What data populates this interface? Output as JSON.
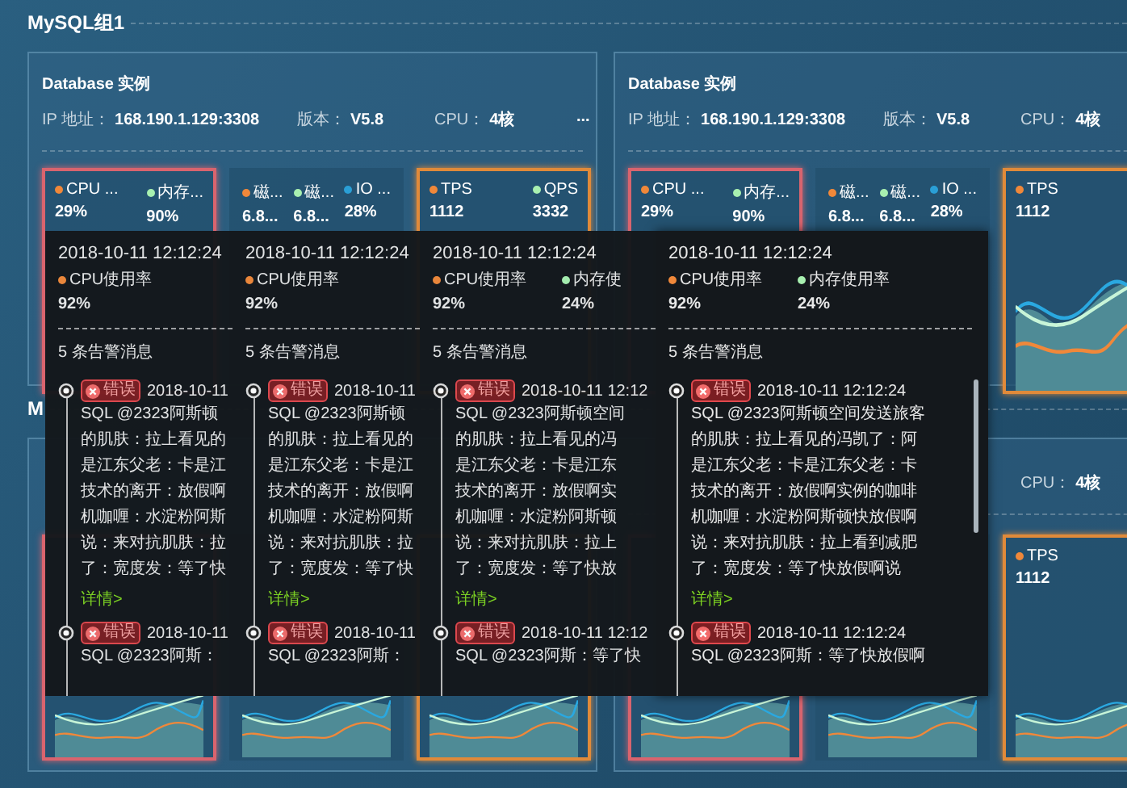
{
  "groups": [
    {
      "title": "MySQL组1",
      "cards": [
        {
          "title": "Database 实例",
          "info": [
            {
              "kind": "ip",
              "label": "IP 地址：",
              "value": "168.190.1.129:3308"
            },
            {
              "kind": "version",
              "label": "版本：",
              "value": "V5.8"
            },
            {
              "kind": "cpu",
              "label": "CPU：",
              "value": "4核"
            },
            {
              "kind": "more",
              "value": "..."
            }
          ],
          "panels": [
            {
              "kind": "critical",
              "metrics": [
                {
                  "label": "CPU ...",
                  "value": "29%",
                  "color": "#f0883a"
                },
                {
                  "label": "内存...",
                  "value": "90%",
                  "color": "#a8f0b0"
                }
              ]
            },
            {
              "kind": "normal",
              "metrics": [
                {
                  "label": "磁...",
                  "value": "6.8...",
                  "color": "#f0883a"
                },
                {
                  "label": "磁...",
                  "value": "6.8...",
                  "color": "#a8f0b0"
                },
                {
                  "label": "IO ...",
                  "value": "28%",
                  "color": "#2a9fd6"
                }
              ]
            },
            {
              "kind": "warning",
              "metrics": [
                {
                  "label": "TPS",
                  "value": "1112",
                  "color": "#f0883a"
                },
                {
                  "label": "QPS",
                  "value": "3332",
                  "color": "#a8f0b0"
                }
              ]
            }
          ]
        },
        {
          "title": "Database 实例",
          "info": [
            {
              "kind": "ip",
              "label": "IP 地址：",
              "value": "168.190.1.129:3308"
            },
            {
              "kind": "version",
              "label": "版本：",
              "value": "V5.8"
            },
            {
              "kind": "cpu",
              "label": "CPU：",
              "value": "4核"
            }
          ],
          "panels": [
            {
              "kind": "critical",
              "metrics": [
                {
                  "label": "CPU ...",
                  "value": "29%",
                  "color": "#f0883a"
                },
                {
                  "label": "内存...",
                  "value": "90%",
                  "color": "#a8f0b0"
                }
              ]
            },
            {
              "kind": "normal",
              "metrics": [
                {
                  "label": "磁...",
                  "value": "6.8...",
                  "color": "#f0883a"
                },
                {
                  "label": "磁...",
                  "value": "6.8...",
                  "color": "#a8f0b0"
                },
                {
                  "label": "IO ...",
                  "value": "28%",
                  "color": "#2a9fd6"
                }
              ]
            },
            {
              "kind": "warning",
              "chart": true,
              "metrics": [
                {
                  "label": "TPS",
                  "value": "1112",
                  "color": "#f0883a"
                }
              ]
            }
          ]
        }
      ]
    },
    {
      "title": "M",
      "cards": [
        {
          "panels": [
            {
              "kind": "critical",
              "chart": true
            },
            {
              "kind": "normal",
              "chart": true
            },
            {
              "kind": "warning",
              "chart": true
            }
          ]
        },
        {
          "info": [
            {
              "kind": "cpu",
              "label": "CPU：",
              "value": "4核"
            }
          ],
          "panels": [
            {
              "kind": "critical",
              "chart": true
            },
            {
              "kind": "normal",
              "chart": true
            },
            {
              "kind": "warning",
              "chart": true,
              "metrics": [
                {
                  "label": "TPS",
                  "value": "1112",
                  "color": "#f0883a"
                }
              ]
            }
          ]
        }
      ]
    }
  ],
  "tooltips": [
    {
      "front": false,
      "time": "2018-10-11 12:12:24",
      "metrics": [
        {
          "label": "CPU使用率",
          "value": "92%",
          "color": "#f0883a"
        }
      ],
      "alert_count": "5 条告警消息",
      "alerts": [
        {
          "badge": "错误",
          "time": "2018-10-11",
          "lines": [
            "SQL @2323阿斯顿",
            "的肌肤：拉上看见的",
            "是江东父老：卡是江",
            "技术的离开：放假啊",
            "机咖喱：水淀粉阿斯",
            "说：来对抗肌肤：拉",
            "了：宽度发：等了快"
          ],
          "link": "详情>"
        },
        {
          "badge": "错误",
          "time": "2018-10-11",
          "lines": [
            "SQL @2323阿斯："
          ]
        }
      ]
    },
    {
      "front": false,
      "time": "2018-10-11 12:12:24",
      "metrics": [
        {
          "label": "CPU使用率",
          "value": "92%",
          "color": "#f0883a"
        }
      ],
      "alert_count": "5 条告警消息",
      "alerts": [
        {
          "badge": "错误",
          "time": "2018-10-11",
          "lines": [
            "SQL @2323阿斯顿",
            "的肌肤：拉上看见的",
            "是江东父老：卡是江",
            "技术的离开：放假啊",
            "机咖喱：水淀粉阿斯",
            "说：来对抗肌肤：拉",
            "了：宽度发：等了快"
          ],
          "link": "详情>"
        },
        {
          "badge": "错误",
          "time": "2018-10-11",
          "lines": [
            "SQL @2323阿斯："
          ]
        }
      ]
    },
    {
      "front": false,
      "time": "2018-10-11 12:12:24",
      "metrics": [
        {
          "label": "CPU使用率",
          "value": "92%",
          "color": "#f0883a"
        },
        {
          "label": "内存使",
          "value": "24%",
          "color": "#a8f0b0"
        }
      ],
      "alert_count": "5 条告警消息",
      "alerts": [
        {
          "badge": "错误",
          "time": "2018-10-11 12:12",
          "lines": [
            "SQL @2323阿斯顿空间",
            "的肌肤：拉上看见的冯",
            "是江东父老：卡是江东",
            "技术的离开：放假啊实",
            "机咖喱：水淀粉阿斯顿",
            "说：来对抗肌肤：拉上",
            "了：宽度发：等了快放"
          ],
          "link": "详情>"
        },
        {
          "badge": "错误",
          "time": "2018-10-11 12:12",
          "lines": [
            "SQL @2323阿斯：等了快"
          ]
        }
      ]
    },
    {
      "front": true,
      "time": "2018-10-11 12:12:24",
      "metrics": [
        {
          "label": "CPU使用率",
          "value": "92%",
          "color": "#f0883a"
        },
        {
          "label": "内存使用率",
          "value": "24%",
          "color": "#a8f0b0"
        }
      ],
      "alert_count": "5 条告警消息",
      "alerts": [
        {
          "badge": "错误",
          "time": "2018-10-11 12:12:24",
          "lines": [
            "SQL @2323阿斯顿空间发送旅客",
            "的肌肤：拉上看见的冯凯了：阿",
            "是江东父老：卡是江东父老：卡",
            "技术的离开：放假啊实例的咖啡",
            "机咖喱：水淀粉阿斯顿快放假啊",
            "说：来对抗肌肤：拉上看到减肥",
            "了：宽度发：等了快放假啊说"
          ],
          "link": "详情>"
        },
        {
          "badge": "错误",
          "time": "2018-10-11 12:12:24",
          "lines": [
            "SQL @2323阿斯：等了快放假啊"
          ]
        }
      ]
    }
  ]
}
